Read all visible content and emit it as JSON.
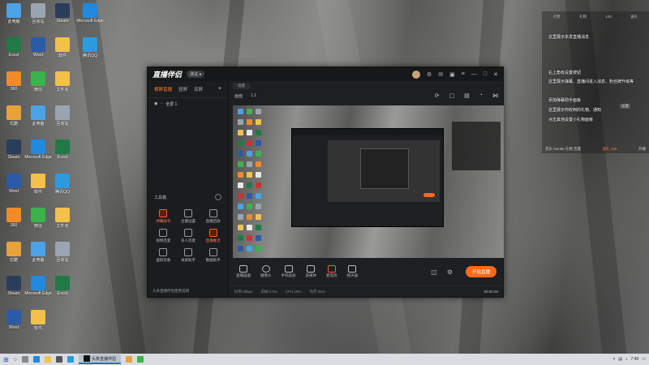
{
  "desktop": {
    "icons": [
      {
        "label": "此电脑",
        "color": "#4aa3e8"
      },
      {
        "label": "回收站",
        "color": "#9aa5b1"
      },
      {
        "label": "Steam",
        "color": "#2a3d5a"
      },
      {
        "label": "Microsoft Edge",
        "color": "#1f8ae0"
      },
      {
        "label": "Excel",
        "color": "#1f7a45"
      },
      {
        "label": "Word",
        "color": "#2b5aa8"
      },
      {
        "label": "软件",
        "color": "#f1c14a"
      },
      {
        "label": "腾讯QQ",
        "color": "#2c9be0"
      },
      {
        "label": "360",
        "color": "#f08a2a"
      },
      {
        "label": "微信",
        "color": "#3cb34a"
      },
      {
        "label": "文件夹",
        "color": "#f1c14a"
      },
      {
        "label": "优酷",
        "color": "#e8a23a"
      }
    ]
  },
  "app": {
    "logo": "直播伴侣",
    "version": "测试 ●",
    "scene_tabs": [
      "横屏直播",
      "竖屏",
      "双屏"
    ],
    "scene_item": "全屏 1",
    "tool_title": "工具箱",
    "tools": [
      {
        "label": "弹幕助手",
        "hot": true
      },
      {
        "label": "主播设置",
        "hot": false
      },
      {
        "label": "直播回放",
        "hot": false
      },
      {
        "label": "视频连麦",
        "hot": false
      },
      {
        "label": "多人连麦",
        "hot": false
      },
      {
        "label": "直播推流",
        "hot": true
      },
      {
        "label": "虚拟形象",
        "hot": false
      },
      {
        "label": "录屏助手",
        "hot": false
      },
      {
        "label": "数据助手",
        "hot": false
      }
    ],
    "left_footer": "头条直播伴侣使用说明",
    "preview_tab": "场景",
    "preview_sub": [
      "画面",
      "1.1"
    ],
    "controls": [
      {
        "label": "直播画面"
      },
      {
        "label": "摄像头"
      },
      {
        "label": "手机投屏"
      },
      {
        "label": "多媒体"
      },
      {
        "label": "麦克风"
      },
      {
        "label": "扬声器"
      }
    ],
    "start_button": "开始直播",
    "status": [
      "码率:0kbps",
      "丢帧:0.0%",
      "CPU:19%",
      "内存:35%"
    ],
    "time": "00:00:00"
  },
  "chat": {
    "header": [
      "点赞",
      "礼物",
      "100",
      "送礼"
    ],
    "lines": [
      "这里展示本发直播消息",
      "右上角有设置按钮",
      "这里展示弹幕、直播间进入消息、粉丝牌升级等",
      "添加弹幕助手面板",
      "这里展示你收到的礼物、通知",
      "点击其他设置小礼物面板"
    ],
    "tag": "设置",
    "footer": [
      "音乐 Gentle 礼物 音量",
      "送礼 100",
      "开播"
    ]
  },
  "taskbar": {
    "task_label": "头条直播伴侣",
    "time": "7:40"
  }
}
